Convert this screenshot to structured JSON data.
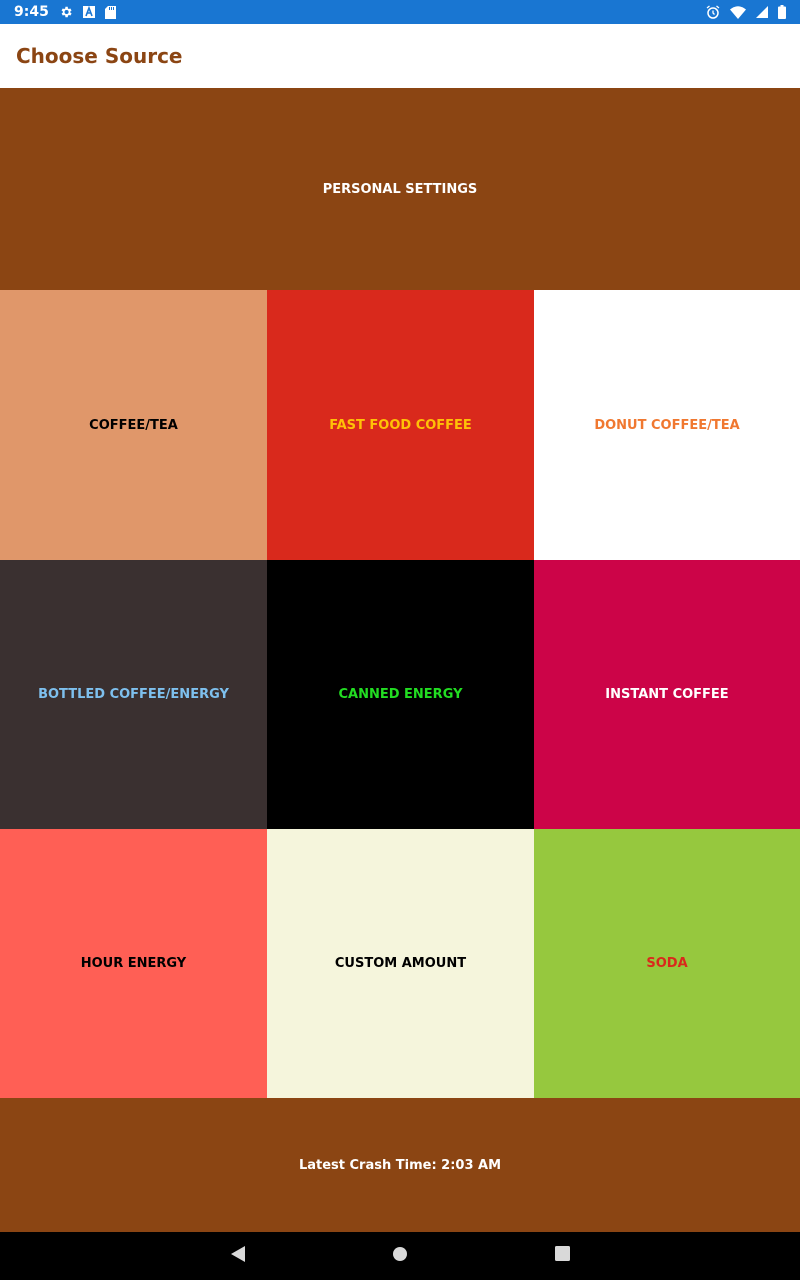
{
  "status_bar": {
    "time": "9:45",
    "background": "#1976d2",
    "left_icons": [
      "gear-icon",
      "a-letter-icon",
      "sd-card-icon"
    ],
    "right_icons": [
      "alarm-icon",
      "wifi-icon",
      "signal-icon",
      "battery-icon"
    ]
  },
  "app_bar": {
    "title": "Choose Source",
    "title_color": "#8b4513"
  },
  "personal_settings": {
    "label": "PERSONAL SETTINGS",
    "background": "#8b4513",
    "text_color": "#ffffff"
  },
  "sources": [
    {
      "label": "COFFEE/TEA",
      "background": "#e0976a",
      "text_color": "#000000"
    },
    {
      "label": "FAST FOOD COFFEE",
      "background": "#d9291c",
      "text_color": "#ffc107"
    },
    {
      "label": "DONUT COFFEE/TEA",
      "background": "#ffffff",
      "text_color": "#f07830"
    },
    {
      "label": "BOTTLED COFFEE/ENERGY",
      "background": "#3a3030",
      "text_color": "#7ec0ee"
    },
    {
      "label": "CANNED ENERGY",
      "background": "#000000",
      "text_color": "#22dd22"
    },
    {
      "label": "INSTANT COFFEE",
      "background": "#cc0448",
      "text_color": "#ffffff"
    },
    {
      "label": "HOUR ENERGY",
      "background": "#ff5f55",
      "text_color": "#000000"
    },
    {
      "label": "CUSTOM AMOUNT",
      "background": "#f5f5dc",
      "text_color": "#000000"
    },
    {
      "label": "SODA",
      "background": "#96c83e",
      "text_color": "#d9291c"
    }
  ],
  "footer": {
    "text": "Latest Crash Time: 2:03 AM",
    "background": "#8b4513",
    "text_color": "#ffffff"
  },
  "nav_bar": {
    "buttons": [
      "back-icon",
      "home-icon",
      "recents-icon"
    ]
  }
}
